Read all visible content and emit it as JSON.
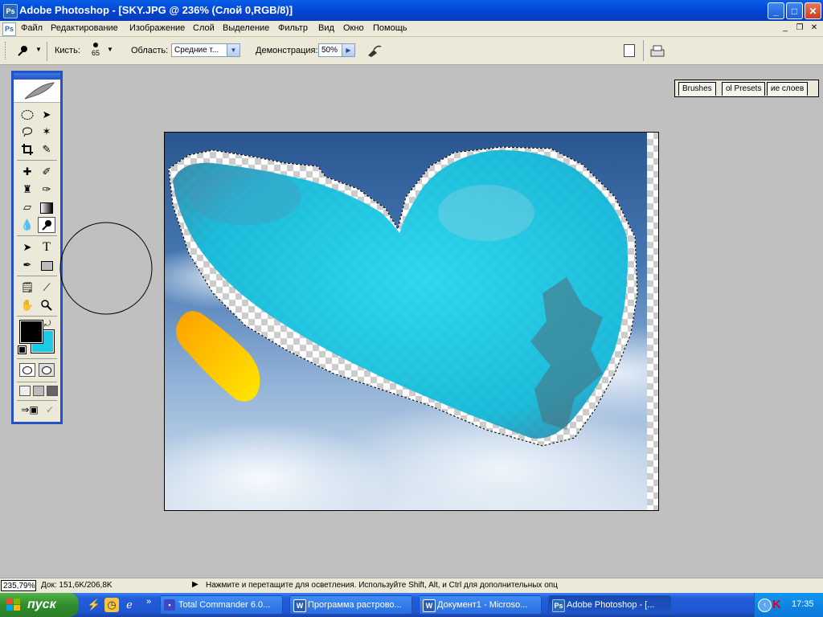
{
  "window": {
    "title": "Adobe Photoshop - [SKY.JPG @ 236% (Слой 0,RGB/8)]",
    "app_icon": "photoshop-icon",
    "controls": {
      "minimize": "_",
      "maximize": "□",
      "close": "✕"
    }
  },
  "menu": {
    "items": [
      "Файл",
      "Редактирование",
      "Изображение",
      "Слой",
      "Выделение",
      "Фильтр",
      "Вид",
      "Окно",
      "Помощь"
    ],
    "doc_controls": {
      "minimize": "_",
      "restore": "❐",
      "close": "✕"
    }
  },
  "options": {
    "brush_label": "Кисть:",
    "brush_size": "65",
    "range_label": "Область:",
    "range_value": "Средние т...",
    "exposure_label": "Демонстрация:",
    "exposure_value": "50%",
    "palette_tabs": [
      "Brushes",
      "ol Presets",
      "ие слоев"
    ]
  },
  "toolbox": {
    "tools": [
      "marquee-tool-icon",
      "move-tool-icon",
      "lasso-tool-icon",
      "magic-wand-tool-icon",
      "crop-tool-icon",
      "slice-tool-icon",
      "healing-brush-icon",
      "brush-tool-icon",
      "clone-stamp-icon",
      "history-brush-icon",
      "eraser-tool-icon",
      "gradient-tool-icon",
      "blur-tool-icon",
      "dodge-tool-icon",
      "path-selection-icon",
      "type-tool-icon",
      "pen-tool-icon",
      "rectangle-tool-icon",
      "notes-tool-icon",
      "eyedropper-tool-icon",
      "hand-tool-icon",
      "zoom-tool-icon"
    ],
    "selected_tool": "dodge-tool-icon",
    "type_tool_glyph": "T",
    "foreground_color": "#000000",
    "background_color": "#1fc8e3"
  },
  "status": {
    "zoom": "235,79%",
    "doc_size": "Док: 151,6K/206,8K",
    "hint": "Нажмите и перетащите для осветления.  Используйте Shift, Alt, и Ctrl для дополнительных опц"
  },
  "taskbar": {
    "start_label": "пуск",
    "quick_launch_more": "»",
    "tasks": [
      {
        "label": "Total Commander 6.0...",
        "icon": "floppy-icon"
      },
      {
        "label": "Программа растрово...",
        "icon": "word-icon"
      },
      {
        "label": "Документ1 - Microso...",
        "icon": "word-icon"
      },
      {
        "label": "Adobe Photoshop - [...",
        "icon": "photoshop-icon",
        "active": true
      }
    ],
    "clock": "17:35"
  }
}
